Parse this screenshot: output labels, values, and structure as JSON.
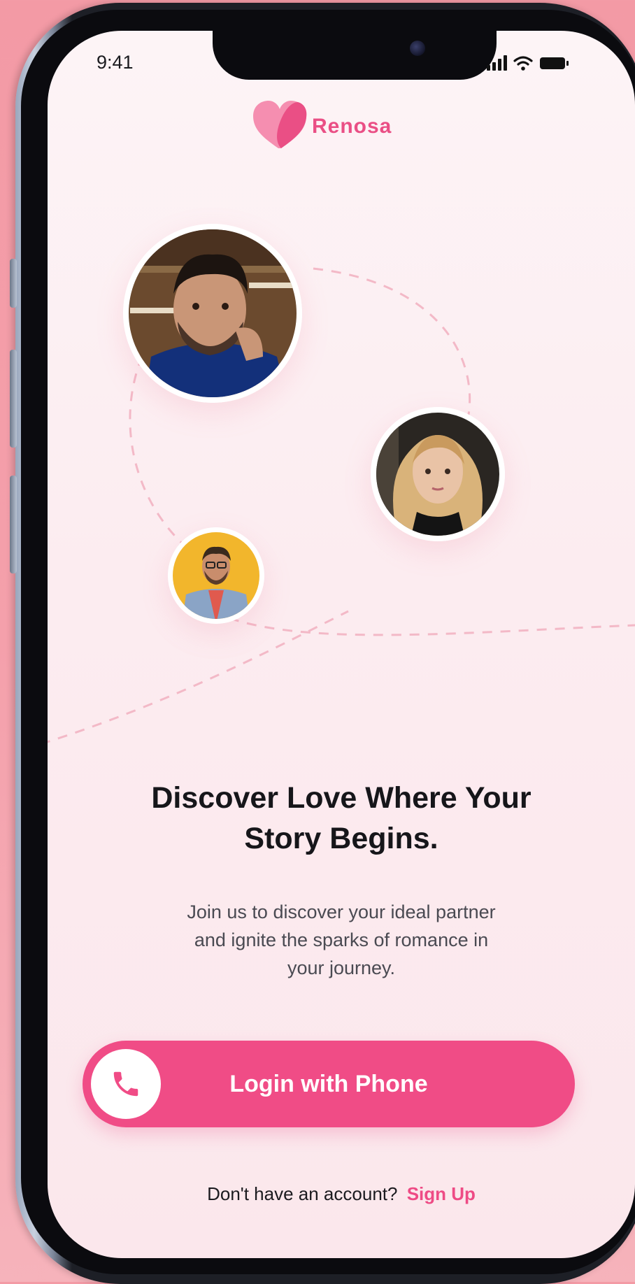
{
  "status_bar": {
    "time": "9:41"
  },
  "brand": {
    "name": "Renosa"
  },
  "profiles": [
    {
      "name": "man-with-beard",
      "icon": "avatar"
    },
    {
      "name": "blonde-woman",
      "icon": "avatar"
    },
    {
      "name": "man-with-glasses",
      "icon": "avatar"
    }
  ],
  "headline": {
    "line1": "Discover Love Where Your",
    "line2": "Story Begins."
  },
  "subtext": {
    "line1": "Join us to discover your ideal partner",
    "line2": "and ignite the sparks of romance in",
    "line3": "your journey."
  },
  "login_button": {
    "label": "Login with Phone",
    "icon": "phone-icon"
  },
  "signup": {
    "prompt": "Don't have an account?",
    "link": "Sign Up"
  },
  "colors": {
    "accent": "#f04c86",
    "brand": "#ea4f85",
    "background": "#fdf1f4"
  }
}
